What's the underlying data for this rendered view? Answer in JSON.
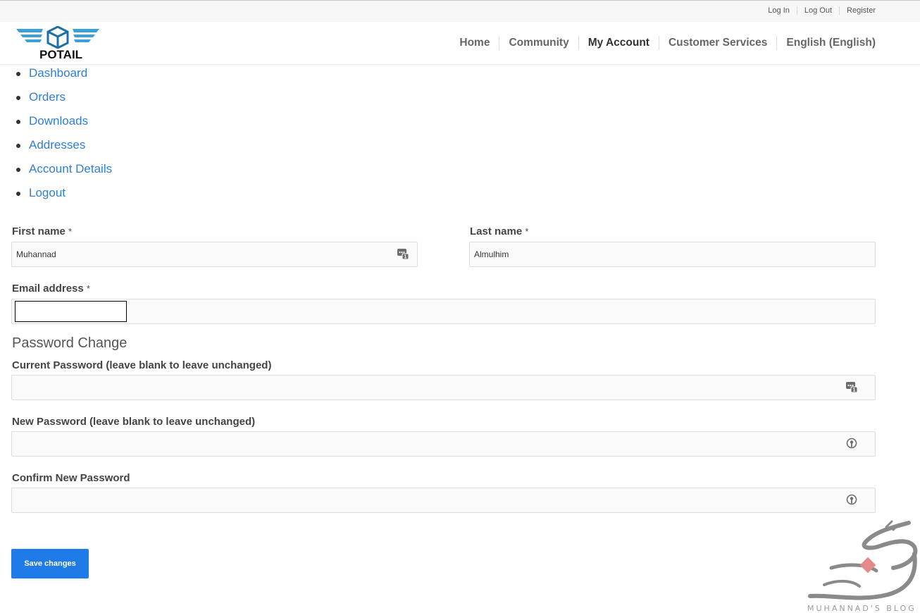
{
  "topbar": {
    "links": [
      "Log In",
      "Log Out",
      "Register"
    ]
  },
  "brand": {
    "name": "POTAIL",
    "colors": {
      "wing": "#3b9fd8",
      "box": "#1e6fa6"
    }
  },
  "mainnav": {
    "items": [
      {
        "label": "Home",
        "active": false
      },
      {
        "label": "Community",
        "active": false
      },
      {
        "label": "My Account",
        "active": true
      },
      {
        "label": "Customer Services",
        "active": false
      },
      {
        "label": "English (English)",
        "active": false
      }
    ]
  },
  "account_nav": {
    "items": [
      "Dashboard",
      "Orders",
      "Downloads",
      "Addresses",
      "Account Details",
      "Logout"
    ]
  },
  "form": {
    "first_name": {
      "label": "First name",
      "required_mark": "*",
      "value": "Muhannad"
    },
    "last_name": {
      "label": "Last name",
      "required_mark": "*",
      "value": "Almulhim"
    },
    "email": {
      "label": "Email address",
      "required_mark": "*",
      "value": ""
    },
    "password_section_title": "Password Change",
    "current_password": {
      "label": "Current Password (leave blank to leave unchanged)",
      "value": ""
    },
    "new_password": {
      "label": "New Password (leave blank to leave unchanged)",
      "value": ""
    },
    "confirm_password": {
      "label": "Confirm New Password",
      "value": ""
    },
    "save_label": "Save changes",
    "icons": {
      "password_manager": "password-manager-icon",
      "key": "key-icon"
    }
  },
  "watermark": {
    "text": "MUHANNAD'S BLOG"
  },
  "colors": {
    "link": "#2f7fd4",
    "button": "#1e7be8"
  }
}
